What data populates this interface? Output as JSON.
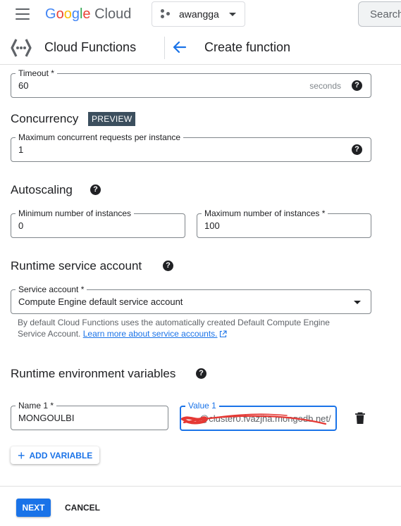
{
  "header": {
    "logo_text": "Google Cloud",
    "project_name": "awangga",
    "search_placeholder": "Search"
  },
  "subheader": {
    "product_title": "Cloud Functions",
    "page_title": "Create function"
  },
  "timeout": {
    "label": "Timeout *",
    "value": "60",
    "suffix": "seconds"
  },
  "concurrency": {
    "title": "Concurrency",
    "badge": "PREVIEW",
    "max_requests_label": "Maximum concurrent requests per instance",
    "max_requests_value": "1"
  },
  "autoscaling": {
    "title": "Autoscaling",
    "min_label": "Minimum number of instances",
    "min_value": "0",
    "max_label": "Maximum number of instances *",
    "max_value": "100"
  },
  "runtime_service_account": {
    "title": "Runtime service account",
    "select_label": "Service account *",
    "select_value": "Compute Engine default service account",
    "hint_text": "By default Cloud Functions uses the automatically created Default Compute Engine Service Account.",
    "hint_link": "Learn more about service accounts."
  },
  "env_vars": {
    "title": "Runtime environment variables",
    "name_label": "Name 1 *",
    "name_value": "MONGOULBI",
    "value_label": "Value 1",
    "value_value": "@cluster0.fvazjha.mongodb.net/",
    "add_label": "ADD VARIABLE"
  },
  "footer": {
    "next_label": "NEXT",
    "cancel_label": "CANCEL"
  },
  "icons": {
    "menu": "hamburger-menu-icon",
    "project": "project-dots-icon",
    "product": "cloud-functions-icon",
    "back": "back-arrow-icon",
    "help": "help-circle-icon",
    "dropdown": "dropdown-caret-icon",
    "external": "external-link-icon",
    "delete": "trash-icon",
    "add": "plus-icon"
  },
  "colors": {
    "accent": "#1a73e8",
    "badge_bg": "#3c4f5e",
    "redaction": "#e53935"
  }
}
